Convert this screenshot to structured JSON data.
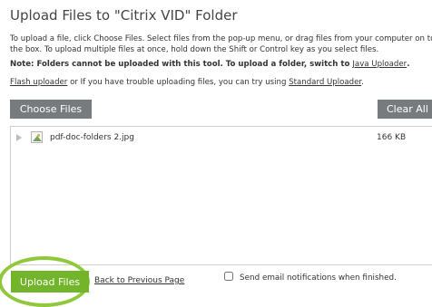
{
  "page": {
    "title": "Upload Files to \"Citrix VID\" Folder",
    "instructions": "To upload a file, click Choose Files. Select files from the pop-up menu, or drag files from your computer on to the box. To upload multiple files at once, hold down the Shift or Control key as you select files.",
    "note_bold": "Note: Folders cannot be uploaded with this tool. To upload a folder, switch to ",
    "note_link": "Java Uploader",
    "note_end": ".",
    "flash_link": "Flash uploader",
    "flash_text": " or If you have trouble uploading files, you can try using ",
    "standard_link": "Standard Uploader",
    "flash_end": "."
  },
  "toolbar": {
    "choose_label": "Choose Files",
    "clear_label": "Clear All"
  },
  "files": [
    {
      "name": "pdf-doc-folders 2.jpg",
      "size": "166 KB",
      "icon": "image-file-icon"
    }
  ],
  "footer": {
    "upload_label": "Upload Files",
    "back_label": "Back to Previous Page",
    "notify_label": "Send email notifications when finished.",
    "notify_checked": false
  },
  "colors": {
    "gray_button": "#777b7e",
    "upload_green": "#72b42a",
    "highlight_ring": "#8fc93b"
  }
}
